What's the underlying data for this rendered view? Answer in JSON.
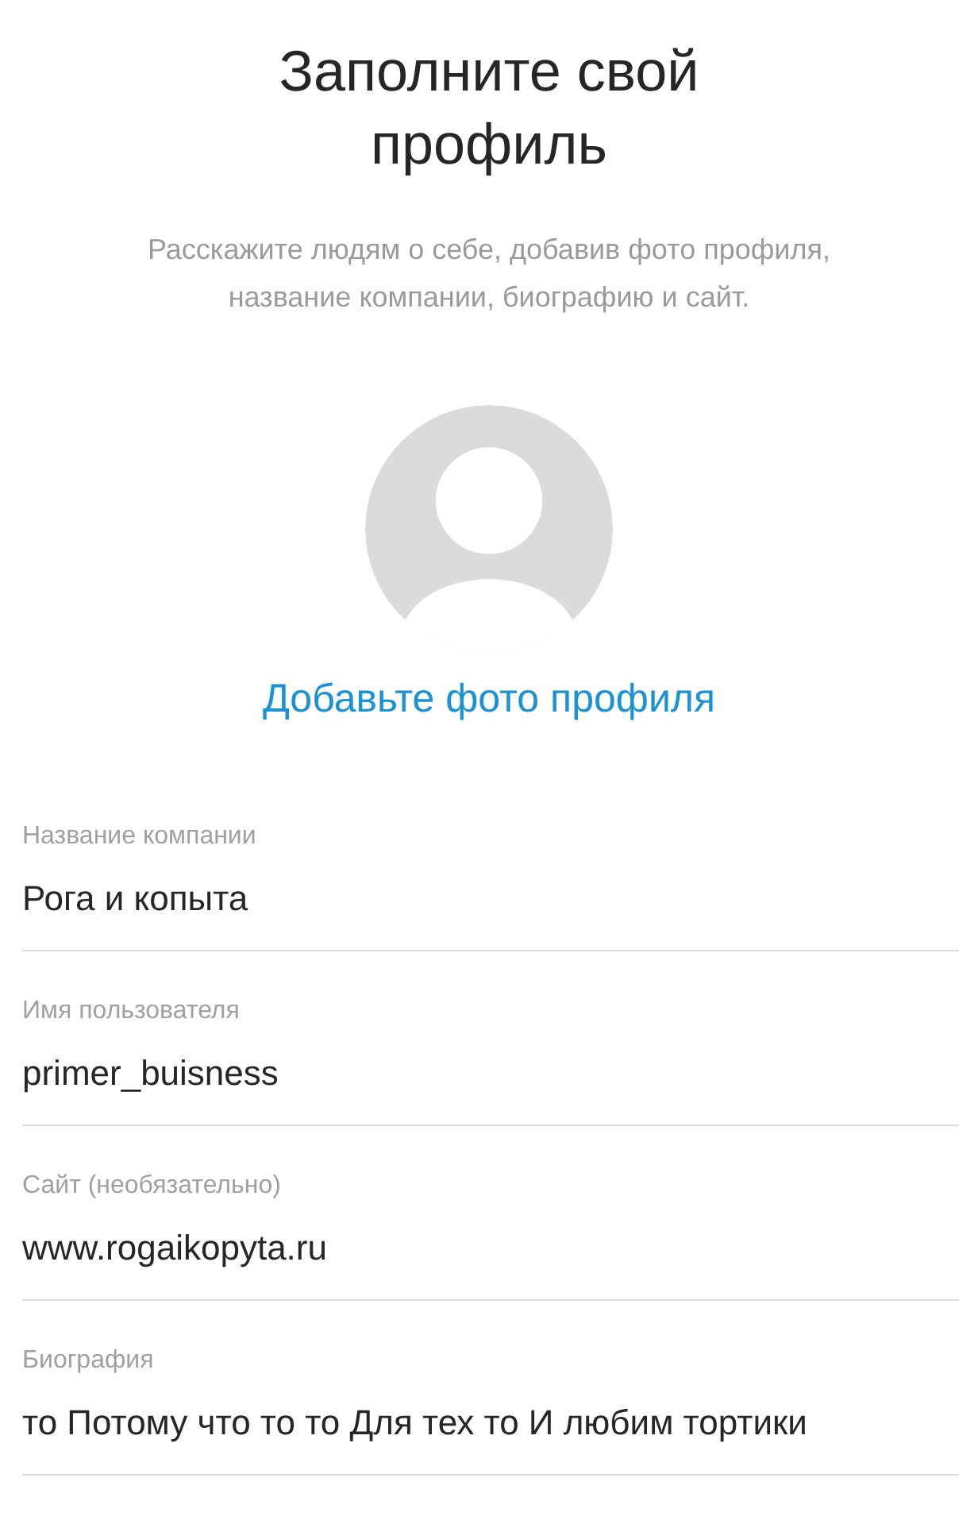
{
  "title": "Заполните свой профиль",
  "subtitle": "Расскажите людям о себе, добавив фото профиля, название компании, биографию и сайт.",
  "add_photo_link": "Добавьте фото профиля",
  "fields": [
    {
      "label": "Название компании",
      "value": "Рога и копыта"
    },
    {
      "label": "Имя пользователя",
      "value": "primer_buisness"
    },
    {
      "label": "Сайт (необязательно)",
      "value": "www.rogaikopyta.ru"
    },
    {
      "label": "Биография",
      "value": "то Потому что то то Для тех то И любим тортики"
    }
  ]
}
